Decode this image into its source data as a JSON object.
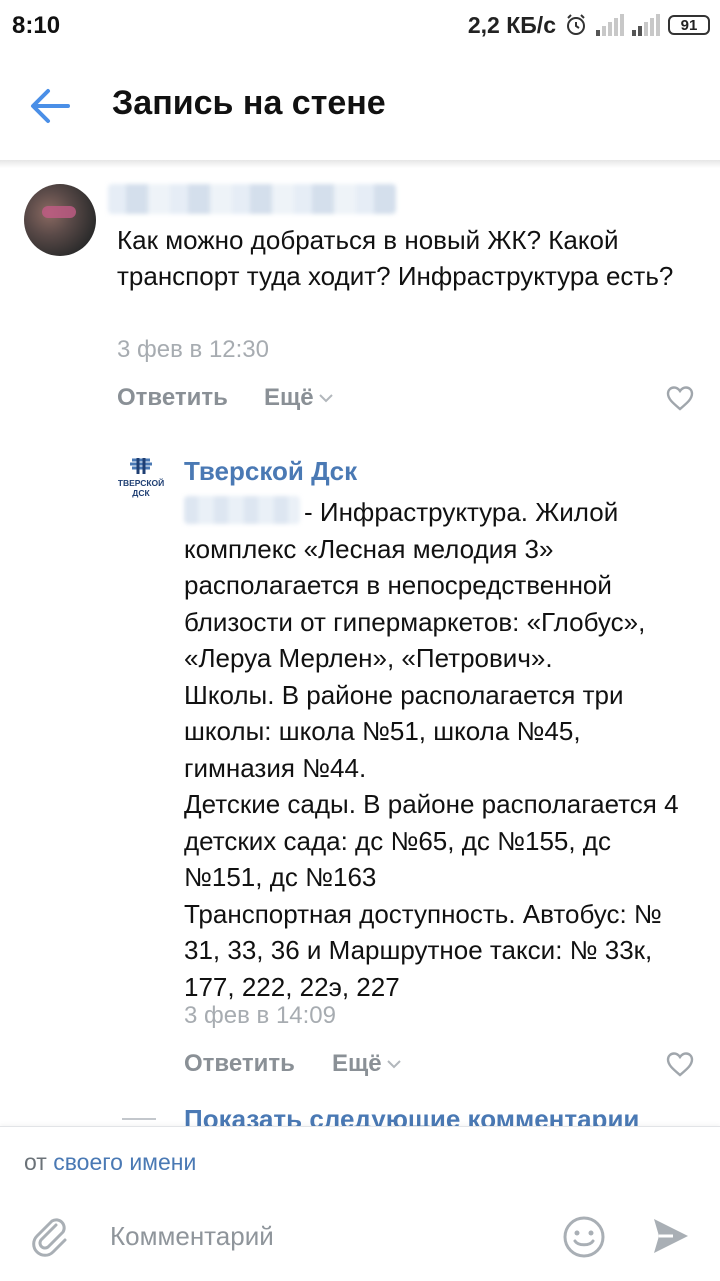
{
  "status_bar": {
    "time": "8:10",
    "speed": "2,2 КБ/с",
    "battery": "91"
  },
  "header": {
    "title": "Запись на стене"
  },
  "comment": {
    "text": "Как можно добраться в новый ЖК? Какой транспорт туда ходит? Инфраструктура есть?",
    "time": "3 фев в 12:30",
    "reply_label": "Ответить",
    "more_label": "Ещё"
  },
  "reply": {
    "author": "Тверской Дск",
    "logo_text": "ТВЕРСКОЙ ДСК",
    "lines": [
      "- Инфраструктура. Жилой комплекс «Лесная мелодия 3» располагается в непосредственной близости от гипермаркетов: «Глобус», «Леруа Мерлен», «Петрович».",
      "Школы. В районе располагается три школы: школа №51, школа №45, гимназия №44.",
      "Детские сады. В районе располагается 4 детских сада: дс №65, дс №155, дс №151, дс №163",
      "Транспортная доступность. Автобус: № 31, 33, 36 и Маршрутное такси: № 33к, 177, 222, 22э, 227"
    ],
    "time": "3 фев в 14:09",
    "reply_label": "Ответить",
    "more_label": "Ещё"
  },
  "show_next": "Показать следующие комментарии",
  "composer": {
    "from_prefix": "от",
    "from_link": "своего имени",
    "placeholder": "Комментарий"
  },
  "colors": {
    "link": "#4a79b4",
    "muted": "#8a9096",
    "accent": "#4a8fe7"
  }
}
